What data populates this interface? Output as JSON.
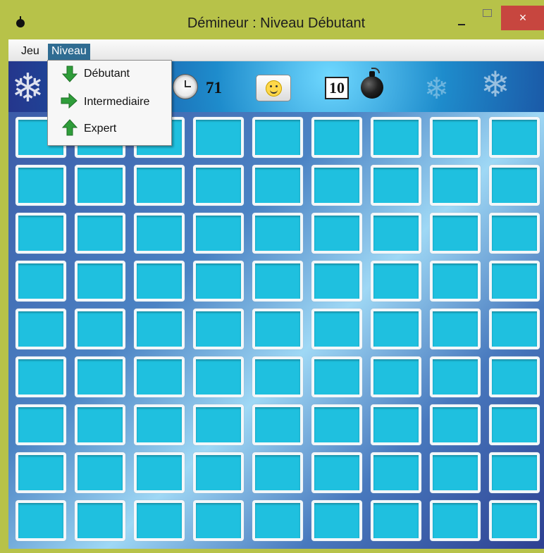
{
  "window": {
    "title": "Démineur : Niveau Débutant",
    "app_icon": "bomb-icon",
    "controls": {
      "minimize": "minimize-icon",
      "maximize": "maximize-icon",
      "close": "×"
    }
  },
  "menubar": {
    "items": [
      "Jeu",
      "Niveau"
    ],
    "active": "Niveau"
  },
  "dropdown": {
    "items": [
      {
        "label": "Débutant",
        "icon": "arrow-down-icon",
        "color": "#2f9d3a"
      },
      {
        "label": "Intermediaire",
        "icon": "arrow-right-icon",
        "color": "#2f9d3a"
      },
      {
        "label": "Expert",
        "icon": "arrow-up-icon",
        "color": "#2f9d3a"
      }
    ]
  },
  "toolbar": {
    "timer_icon": "stopwatch-icon",
    "timer_value": "71",
    "smiley_icon": "smiley-face-icon",
    "mine_counter": "10",
    "mine_icon": "bomb-icon"
  },
  "board": {
    "rows": 9,
    "cols": 9,
    "cell_state": "unrevealed",
    "cell_color": "#1fc0df"
  },
  "colors": {
    "title_bar": "#b7c249",
    "close_button": "#c7463f",
    "menu_highlight": "#2f6c92"
  }
}
